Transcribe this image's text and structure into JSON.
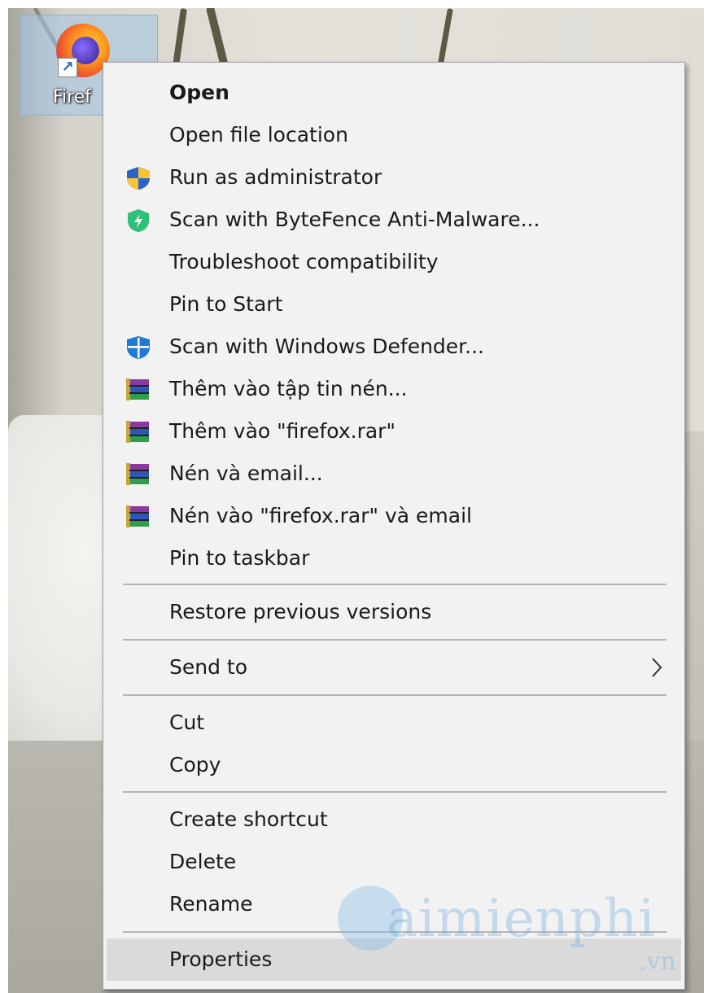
{
  "desktop": {
    "icon_label": "Firef",
    "icon_name": "firefox-icon"
  },
  "menu": {
    "items": [
      {
        "label": "Open",
        "icon": null,
        "bold": true
      },
      {
        "label": "Open file location",
        "icon": null
      },
      {
        "label": "Run as administrator",
        "icon": "uac-shield-icon"
      },
      {
        "label": "Scan with ByteFence Anti-Malware...",
        "icon": "bytefence-shield-icon"
      },
      {
        "label": "Troubleshoot compatibility",
        "icon": null
      },
      {
        "label": "Pin to Start",
        "icon": null
      },
      {
        "label": "Scan with Windows Defender...",
        "icon": "windows-defender-icon"
      },
      {
        "label": "Thêm vào tập tin nén...",
        "icon": "winrar-icon"
      },
      {
        "label": "Thêm vào \"firefox.rar\"",
        "icon": "winrar-icon"
      },
      {
        "label": "Nén và email...",
        "icon": "winrar-icon"
      },
      {
        "label": "Nén vào \"firefox.rar\" và email",
        "icon": "winrar-icon"
      },
      {
        "label": "Pin to taskbar",
        "icon": null
      },
      {
        "label": "Restore previous versions",
        "icon": null
      },
      {
        "label": "Send to",
        "icon": null,
        "submenu": true
      },
      {
        "label": "Cut",
        "icon": null
      },
      {
        "label": "Copy",
        "icon": null
      },
      {
        "label": "Create shortcut",
        "icon": null
      },
      {
        "label": "Delete",
        "icon": null
      },
      {
        "label": "Rename",
        "icon": null
      },
      {
        "label": "Properties",
        "icon": null,
        "highlighted": true
      }
    ]
  },
  "watermark": {
    "text": "aimienphi",
    "sub": ".vn"
  },
  "colors": {
    "menu_bg": "#f2f2f2",
    "hover_bg": "#dadada",
    "separator": "#b5b5b5"
  }
}
